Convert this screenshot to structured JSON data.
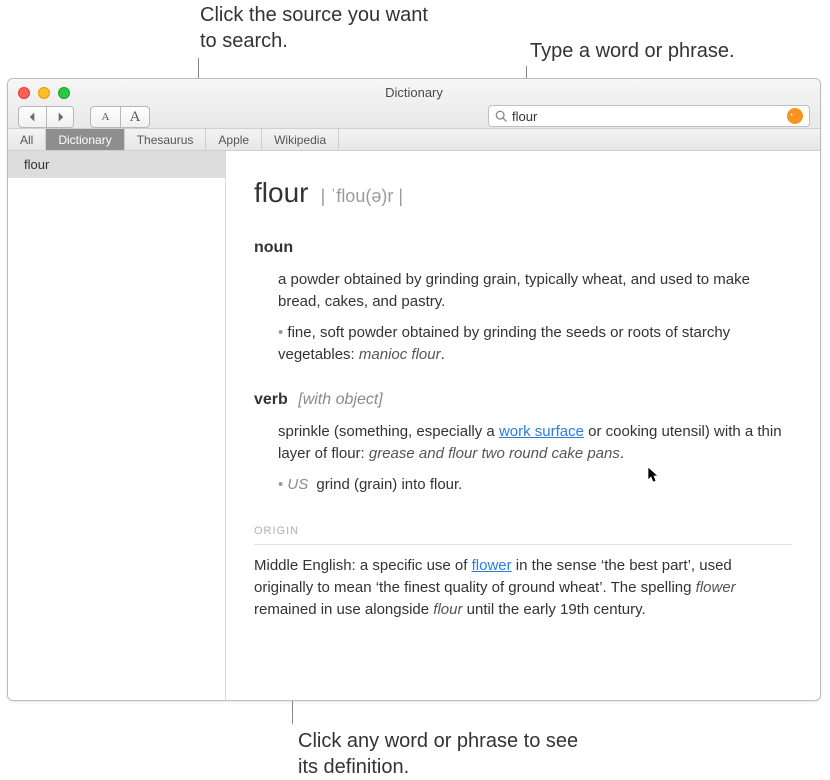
{
  "annotations": {
    "top_left": "Click the source you want to search.",
    "top_right": "Type a word or phrase.",
    "bottom": "Click any word or phrase to see its definition."
  },
  "window": {
    "title": "Dictionary"
  },
  "toolbar": {
    "font_small": "A",
    "font_large": "A"
  },
  "search": {
    "value": "flour"
  },
  "tabs": [
    {
      "label": "All",
      "active": false
    },
    {
      "label": "Dictionary",
      "active": true
    },
    {
      "label": "Thesaurus",
      "active": false
    },
    {
      "label": "Apple",
      "active": false
    },
    {
      "label": "Wikipedia",
      "active": false
    }
  ],
  "sidebar": {
    "items": [
      {
        "label": "flour",
        "selected": true
      }
    ]
  },
  "entry": {
    "headword": "flour",
    "pronunciation": "| ˈflou(ə)r |",
    "pos1": "noun",
    "def1": "a powder obtained by grinding grain, typically wheat, and used to make bread, cakes, and pastry.",
    "sub1_text": "fine, soft powder obtained by grinding the seeds or roots of starchy vegetables: ",
    "sub1_example": "manioc flour",
    "sub1_period": ".",
    "pos2": "verb",
    "pos2_gram": "[with object]",
    "def2_a": "sprinkle (something, especially a ",
    "def2_link": "work surface",
    "def2_b": " or cooking utensil) with a thin layer of flour: ",
    "def2_example": "grease and flour two round cake pans",
    "def2_period": ".",
    "sub2_region": "US",
    "sub2_text": " grind (grain) into flour.",
    "origin_label": "ORIGIN",
    "origin_a": "Middle English: a specific use of ",
    "origin_link": "flower",
    "origin_b": " in the sense ‘the best part’, used originally to mean ‘the finest quality of ground wheat’. The spelling ",
    "origin_i1": "flower",
    "origin_c": " remained in use alongside ",
    "origin_i2": "flour",
    "origin_d": " until the early 19th century."
  }
}
